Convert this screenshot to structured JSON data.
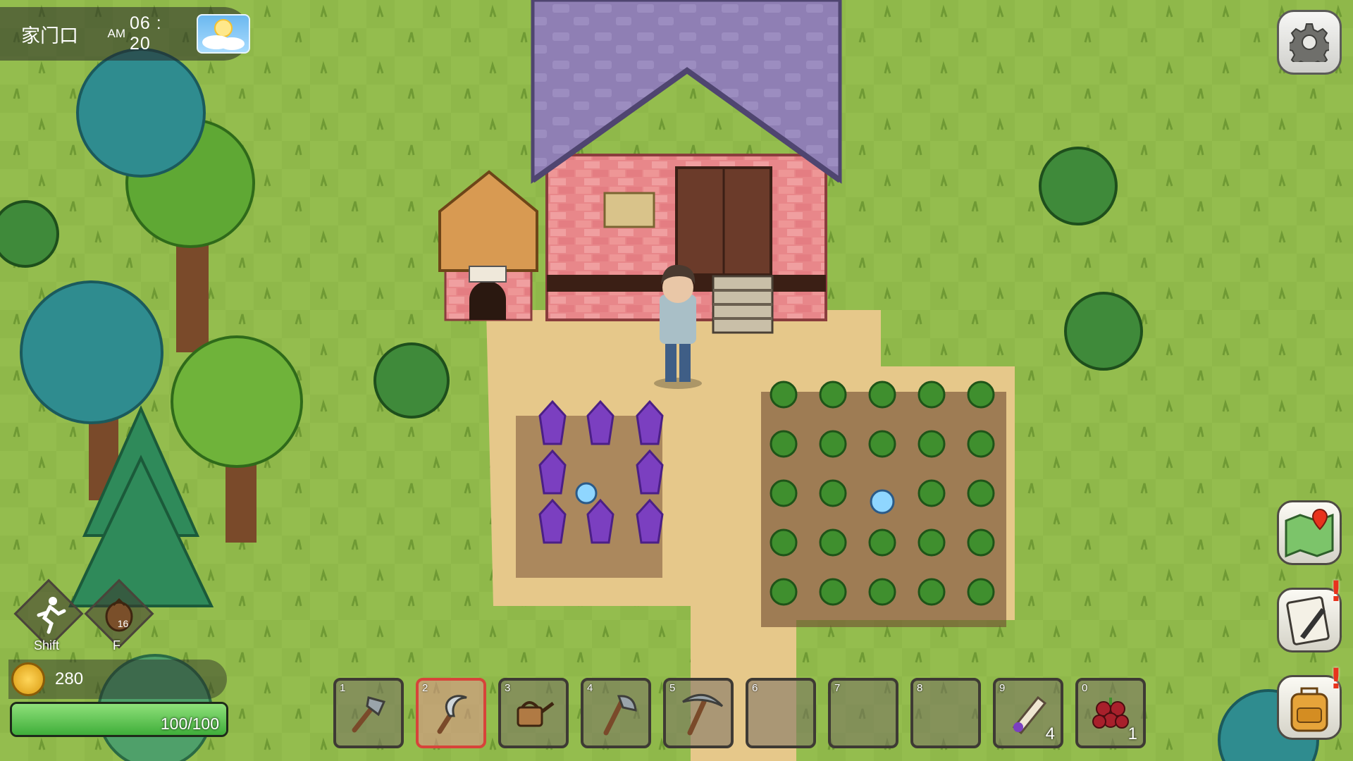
{
  "hud": {
    "location": "家门口",
    "ampm": "AM",
    "time": "06 : 20",
    "weather_icon": "sunny-icon"
  },
  "skills": [
    {
      "name": "sprint",
      "key": "Shift"
    },
    {
      "name": "seed-pouch",
      "key": "F",
      "count": "16"
    }
  ],
  "wallet": {
    "coins": "280"
  },
  "health": {
    "current": 100,
    "max": 100,
    "text": "100/100",
    "fraction": 1.0
  },
  "hotbar": {
    "selected_slot": 2,
    "slots": [
      {
        "num": "1",
        "item": "hoe-icon",
        "qty": ""
      },
      {
        "num": "2",
        "item": "sickle-icon",
        "qty": ""
      },
      {
        "num": "3",
        "item": "watering-can-icon",
        "qty": ""
      },
      {
        "num": "4",
        "item": "axe-icon",
        "qty": ""
      },
      {
        "num": "5",
        "item": "pickaxe-icon",
        "qty": ""
      },
      {
        "num": "6",
        "item": "",
        "qty": ""
      },
      {
        "num": "7",
        "item": "",
        "qty": ""
      },
      {
        "num": "8",
        "item": "",
        "qty": ""
      },
      {
        "num": "9",
        "item": "seed-packet-icon",
        "qty": "4"
      },
      {
        "num": "0",
        "item": "berries-icon",
        "qty": "1"
      }
    ]
  },
  "side_buttons": [
    "map-icon",
    "journal-icon",
    "backpack-icon"
  ],
  "alerts": {
    "journal": "!",
    "backpack": "!"
  },
  "colors": {
    "grass": "#8fb84a",
    "dirt": "#e6c88a",
    "roof": "#8f7fb4",
    "brick": "#e8878a",
    "crop_purple": "#7b3fc0",
    "crop_green": "#3f8f2e",
    "health": "#3fae3a",
    "selected_slot": "#d7443a"
  }
}
